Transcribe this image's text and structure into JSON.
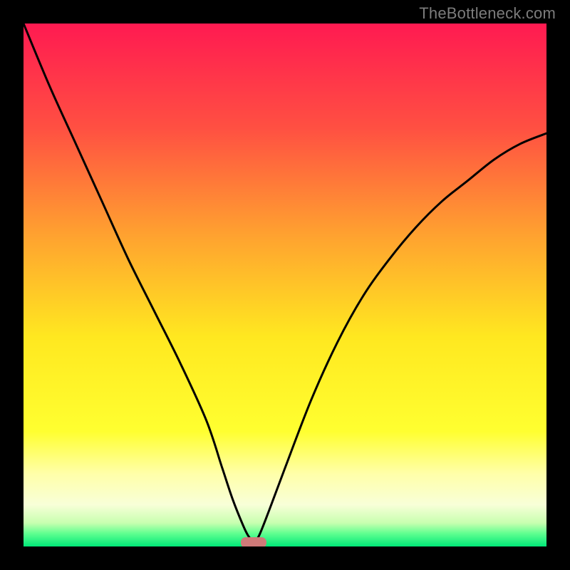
{
  "watermark": {
    "text": "TheBottleneck.com"
  },
  "chart_data": {
    "type": "line",
    "title": "",
    "xlabel": "",
    "ylabel": "",
    "xlim": [
      0,
      100
    ],
    "ylim": [
      0,
      100
    ],
    "x": [
      0,
      5,
      10,
      15,
      20,
      25,
      30,
      35,
      38,
      40,
      42,
      43,
      44,
      45,
      47,
      50,
      55,
      60,
      65,
      70,
      75,
      80,
      85,
      90,
      95,
      100
    ],
    "series": [
      {
        "name": "bottleneck-curve",
        "values": [
          100,
          88,
          77,
          66,
          55,
          45,
          35,
          24,
          15,
          9,
          4,
          2,
          1,
          2,
          7,
          15,
          28,
          39,
          48,
          55,
          61,
          66,
          70,
          74,
          77,
          79
        ]
      }
    ],
    "marker": {
      "x": 44,
      "y": 0,
      "color": "#cf7a79"
    },
    "gradient_stops": [
      {
        "offset": 0,
        "color": "#ff1a51"
      },
      {
        "offset": 0.2,
        "color": "#ff5042"
      },
      {
        "offset": 0.4,
        "color": "#ffa030"
      },
      {
        "offset": 0.6,
        "color": "#ffe820"
      },
      {
        "offset": 0.78,
        "color": "#ffff30"
      },
      {
        "offset": 0.86,
        "color": "#ffffa8"
      },
      {
        "offset": 0.92,
        "color": "#f8ffd8"
      },
      {
        "offset": 0.955,
        "color": "#c8ffb0"
      },
      {
        "offset": 0.975,
        "color": "#60ff90"
      },
      {
        "offset": 1.0,
        "color": "#00e878"
      }
    ]
  }
}
